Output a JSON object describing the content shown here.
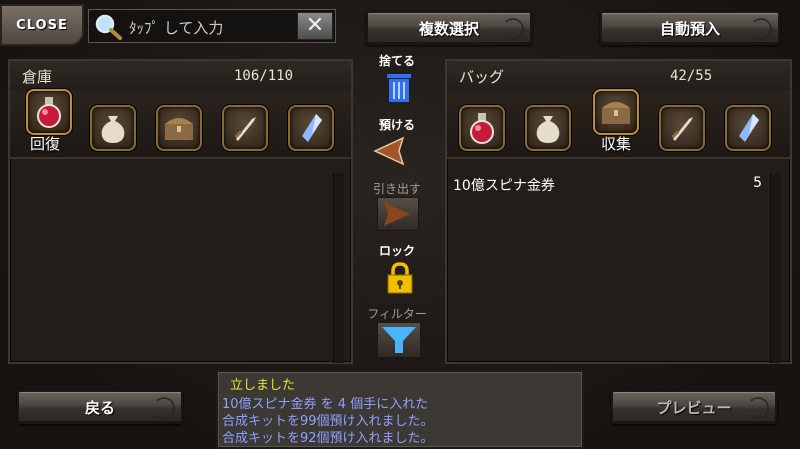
{
  "close_label": "CLOSE",
  "search": {
    "placeholder": "ﾀｯﾌﾟ して入力",
    "clear": "✕"
  },
  "header_buttons": {
    "multi_select": "複数選択",
    "auto_deposit": "自動預入"
  },
  "storage": {
    "title": "倉庫",
    "count": "106/110",
    "selected_tab_label": "回復",
    "tabs": [
      "recovery-potion",
      "bag",
      "chest",
      "sword",
      "crystal"
    ]
  },
  "bag": {
    "title": "バッグ",
    "count": "42/55",
    "selected_tab_label": "収集",
    "tabs": [
      "recovery-potion",
      "bag",
      "chest",
      "sword",
      "crystal"
    ],
    "items": [
      {
        "name": "10億スピナ金券",
        "qty": "5"
      }
    ]
  },
  "middle": {
    "discard": "捨てる",
    "deposit": "預ける",
    "withdraw": "引き出す",
    "lock": "ロック",
    "filter": "フィルター"
  },
  "footer": {
    "back": "戻る",
    "preview": "プレビュー"
  },
  "log": [
    {
      "text": "立しました",
      "color": "#e3e32a"
    },
    {
      "text": "10億スピナ金券 を 4 個手に入れた",
      "color": "#8fa0ff"
    },
    {
      "text": "合成キットを99個預け入れました。",
      "color": "#8fa0ff"
    },
    {
      "text": "合成キットを92個預け入れました。",
      "color": "#8fa0ff"
    }
  ],
  "colors": {
    "accent_gold": "#c08a36",
    "trash_blue": "#2f6ff0",
    "lock_gold": "#f0c000",
    "filter_blue": "#4ab3ff"
  }
}
